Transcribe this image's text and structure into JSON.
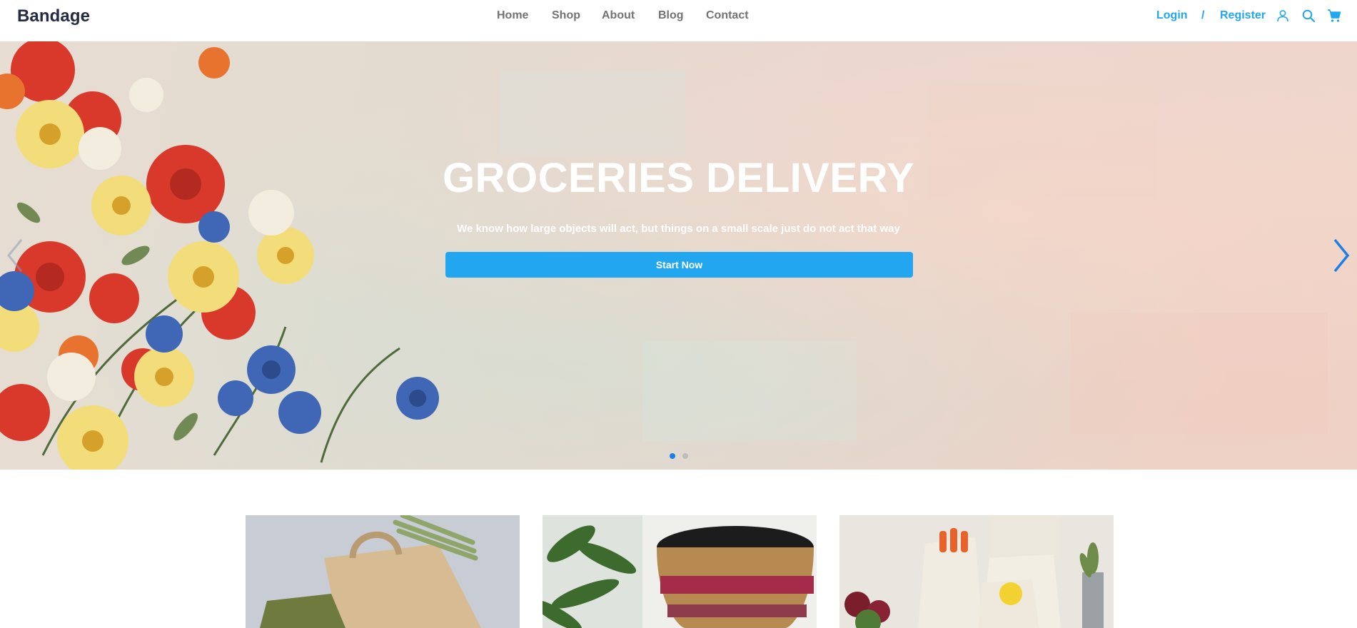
{
  "header": {
    "brand": "Bandage",
    "nav": [
      "Home",
      "Shop",
      "About",
      "Blog",
      "Contact"
    ],
    "login_label": "Login",
    "separator": "/",
    "register_label": "Register",
    "icons": [
      "user-icon",
      "search-icon",
      "cart-icon"
    ]
  },
  "hero": {
    "title": "GROCERIES DELIVERY",
    "subtitle": "We know how large objects will act, but things on a small scale just do not act that way",
    "cta_label": "Start Now",
    "slide_count": 2,
    "active_slide": 1
  },
  "colors": {
    "accent": "#23A6F0",
    "heading": "#252B42",
    "nav_text": "#737373",
    "active_dot": "#1a7fe8"
  },
  "tiles": [
    "paper-bag-image",
    "woven-basket-image",
    "cotton-produce-bags-image"
  ]
}
